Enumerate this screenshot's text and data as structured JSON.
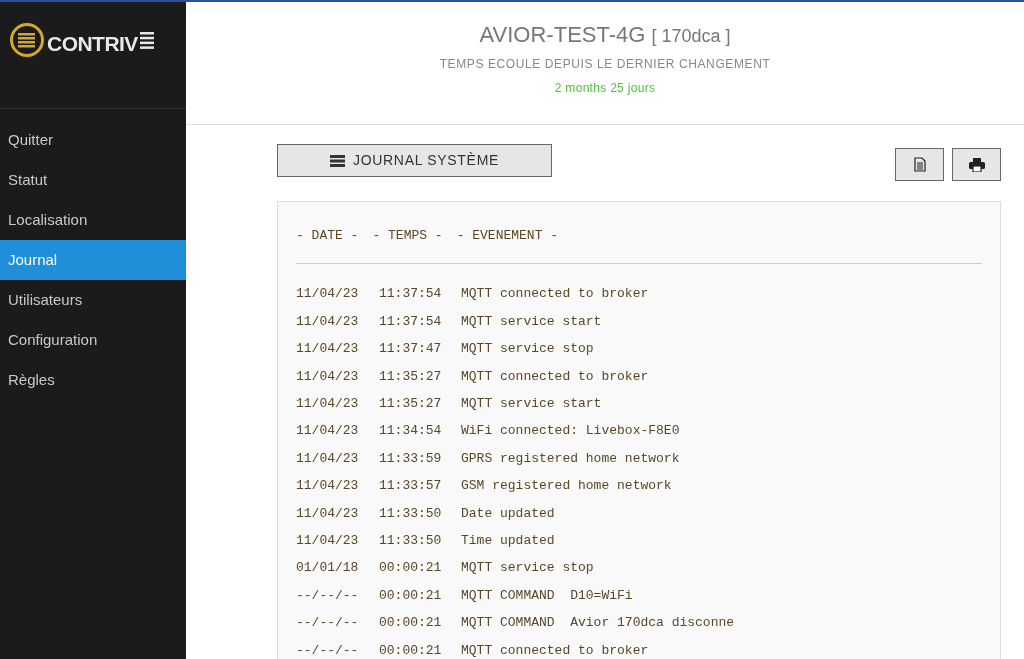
{
  "logo": {
    "text": "CONTRIV"
  },
  "sidebar": {
    "items": [
      {
        "label": "Quitter",
        "selected": false
      },
      {
        "label": "Statut",
        "selected": false
      },
      {
        "label": "Localisation",
        "selected": false
      },
      {
        "label": "Journal",
        "selected": true
      },
      {
        "label": "Utilisateurs",
        "selected": false
      },
      {
        "label": "Configuration",
        "selected": false
      },
      {
        "label": "Règles",
        "selected": false
      }
    ]
  },
  "header": {
    "device": "AVIOR-TEST-4G",
    "id": "[ 170dca ]",
    "subtitle": "TEMPS ECOULE DEPUIS LE DERNIER CHANGEMENT",
    "elapsed": "2 months 25 jours"
  },
  "journal_button": {
    "label": "JOURNAL SYSTÈME"
  },
  "log": {
    "columns": [
      "- DATE -",
      "- TEMPS -",
      "- EVENEMENT -"
    ],
    "rows": [
      [
        "11/04/23",
        "11:37:54",
        "MQTT connected to broker"
      ],
      [
        "11/04/23",
        "11:37:54",
        "MQTT service start"
      ],
      [
        "11/04/23",
        "11:37:47",
        "MQTT service stop"
      ],
      [
        "11/04/23",
        "11:35:27",
        "MQTT connected to broker"
      ],
      [
        "11/04/23",
        "11:35:27",
        "MQTT service start"
      ],
      [
        "11/04/23",
        "11:34:54",
        "WiFi connected: Livebox-F8E0"
      ],
      [
        "11/04/23",
        "11:33:59",
        "GPRS registered home network"
      ],
      [
        "11/04/23",
        "11:33:57",
        "GSM registered home network"
      ],
      [
        "11/04/23",
        "11:33:50",
        "Date updated"
      ],
      [
        "11/04/23",
        "11:33:50",
        "Time updated"
      ],
      [
        "01/01/18",
        "00:00:21",
        "MQTT service stop"
      ],
      [
        "--/--/--",
        "00:00:21",
        "MQTT COMMAND  D10=WiFi"
      ],
      [
        "--/--/--",
        "00:00:21",
        "MQTT COMMAND  Avior 170dca disconne"
      ],
      [
        "--/--/--",
        "00:00:21",
        "MQTT connected to broker"
      ]
    ]
  }
}
